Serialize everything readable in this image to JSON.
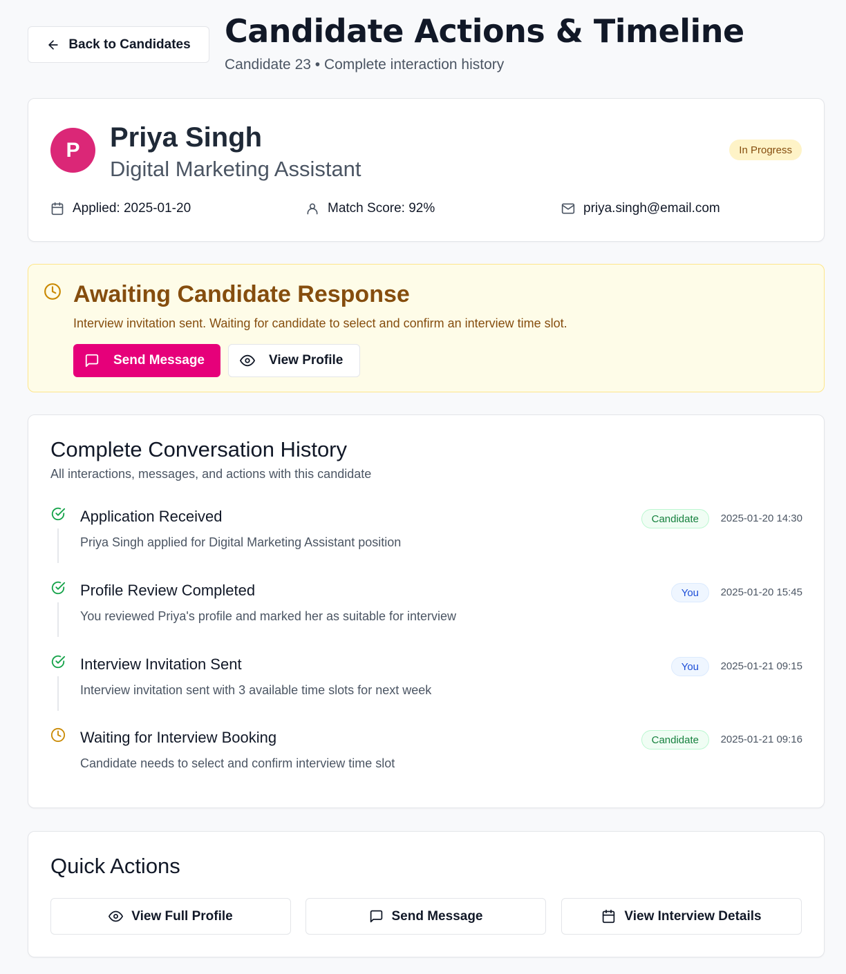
{
  "header": {
    "back_label": "Back to Candidates",
    "title": "Candidate Actions & Timeline",
    "subtitle": "Candidate 23 • Complete interaction history"
  },
  "candidate": {
    "avatar_initial": "P",
    "name": "Priya Singh",
    "role": "Digital Marketing Assistant",
    "status": "In Progress",
    "applied": "Applied: 2025-01-20",
    "match_score": "Match Score: 92%",
    "email": "priya.singh@email.com"
  },
  "alert": {
    "title": "Awaiting Candidate Response",
    "text": "Interview invitation sent. Waiting for candidate to select and confirm an interview time slot.",
    "primary_label": "Send Message",
    "secondary_label": "View Profile"
  },
  "history": {
    "title": "Complete Conversation History",
    "subtitle": "All interactions, messages, and actions with this candidate",
    "items": [
      {
        "title": "Application Received",
        "desc": "Priya Singh applied for Digital Marketing Assistant position",
        "actor": "Candidate",
        "time": "2025-01-20 14:30",
        "status": "done"
      },
      {
        "title": "Profile Review Completed",
        "desc": "You reviewed Priya's profile and marked her as suitable for interview",
        "actor": "You",
        "time": "2025-01-20 15:45",
        "status": "done"
      },
      {
        "title": "Interview Invitation Sent",
        "desc": "Interview invitation sent with 3 available time slots for next week",
        "actor": "You",
        "time": "2025-01-21 09:15",
        "status": "done"
      },
      {
        "title": "Waiting for Interview Booking",
        "desc": "Candidate needs to select and confirm interview time slot",
        "actor": "Candidate",
        "time": "2025-01-21 09:16",
        "status": "pending"
      }
    ]
  },
  "quick_actions": {
    "title": "Quick Actions",
    "view_profile": "View Full Profile",
    "send_message": "Send Message",
    "view_interview": "View Interview Details"
  },
  "colors": {
    "brand": "#e6007a",
    "avatar": "#db2777",
    "success": "#16a34a",
    "warning": "#ca8a04"
  }
}
